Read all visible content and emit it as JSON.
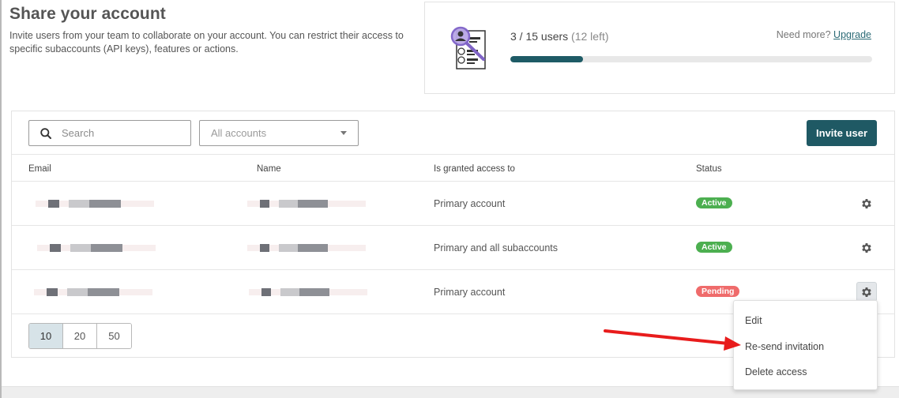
{
  "header": {
    "title": "Share your account",
    "description": "Invite users from your team to collaborate on your account. You can restrict their access to specific subaccounts (API keys), features or actions."
  },
  "usage": {
    "count_text": "3 / 15 users",
    "left_text": "(12 left)",
    "need_more": "Need more?",
    "upgrade_link": "Upgrade",
    "progress_fraction": 0.2,
    "accent_color": "#1e5b66"
  },
  "toolbar": {
    "search_placeholder": "Search",
    "accounts_select": "All accounts",
    "invite_label": "Invite user"
  },
  "table": {
    "columns": [
      "Email",
      "Name",
      "Is granted access to",
      "Status"
    ],
    "rows": [
      {
        "access": "Primary account",
        "status": "Active"
      },
      {
        "access": "Primary and all subaccounts",
        "status": "Active"
      },
      {
        "access": "Primary account",
        "status": "Pending"
      }
    ]
  },
  "pagination": {
    "options": [
      "10",
      "20",
      "50"
    ],
    "selected": "10"
  },
  "row_menu": {
    "items": [
      "Edit",
      "Re-send invitation",
      "Delete access"
    ]
  },
  "colors": {
    "active": "#4caf50",
    "pending": "#ef6b6b",
    "primary_button": "#1f5964"
  }
}
